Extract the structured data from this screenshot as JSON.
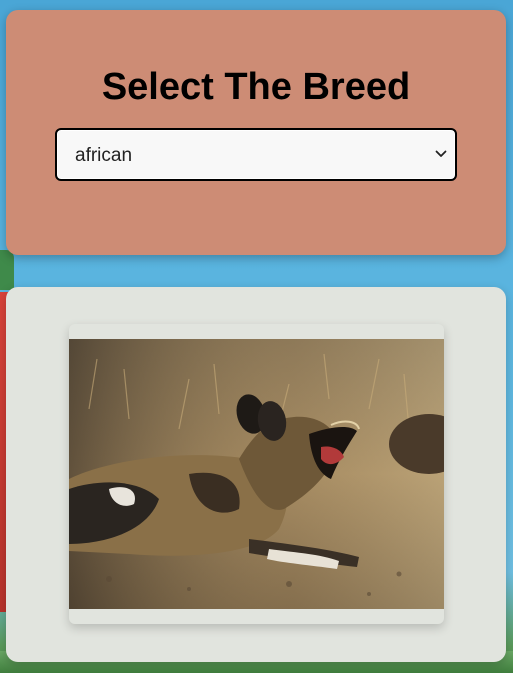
{
  "breed_selector": {
    "title": "Select The Breed",
    "selected": "african"
  },
  "breed_image": {
    "icon": "dog-photo",
    "colors": {
      "ground": "#8a7355",
      "dog_tan": "#a07d4a",
      "dog_dark": "#2a2520"
    }
  },
  "colors": {
    "breed_panel": "#cd8c75",
    "image_panel": "#e1e4de",
    "background_sky": "#5fb8e0"
  }
}
